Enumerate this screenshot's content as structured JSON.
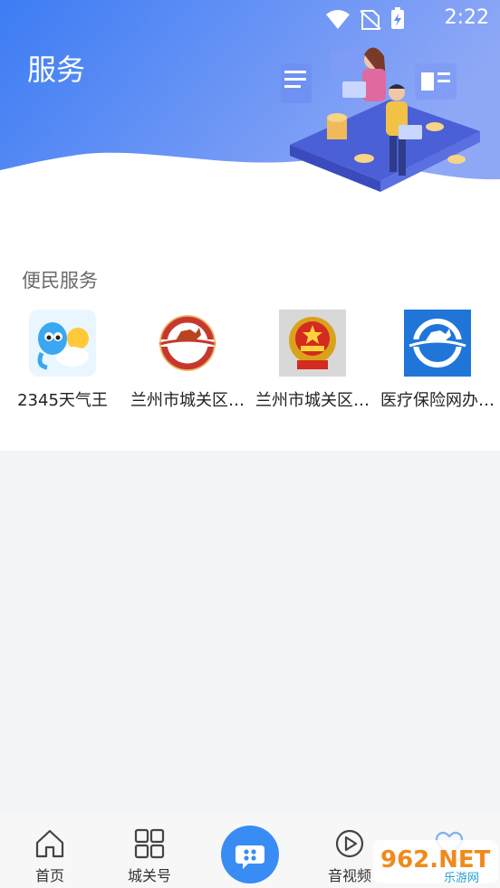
{
  "status_bar": {
    "time": "2:22"
  },
  "header": {
    "title": "服务"
  },
  "section": {
    "title": "便民服务"
  },
  "apps": [
    {
      "label": "2345天气王",
      "icon": "weather-app-icon"
    },
    {
      "label": "兰州市城关区…",
      "icon": "horse-logo-icon"
    },
    {
      "label": "兰州市城关区…",
      "icon": "national-emblem-icon"
    },
    {
      "label": "医疗保险网办…",
      "icon": "insurance-horse-icon"
    }
  ],
  "tabs": [
    {
      "label": "首页",
      "icon": "home-icon"
    },
    {
      "label": "城关号",
      "icon": "grid-icon"
    },
    {
      "label": "",
      "icon": "chat-bubble-icon"
    },
    {
      "label": "音视频",
      "icon": "play-icon"
    },
    {
      "label": "",
      "icon": "heart-icon"
    }
  ],
  "watermark": {
    "text": "962.NET",
    "sub": "乐游网"
  },
  "colors": {
    "accent": "#3a8cf5",
    "header_start": "#3f7ff5",
    "header_end": "#8aa7f7"
  }
}
